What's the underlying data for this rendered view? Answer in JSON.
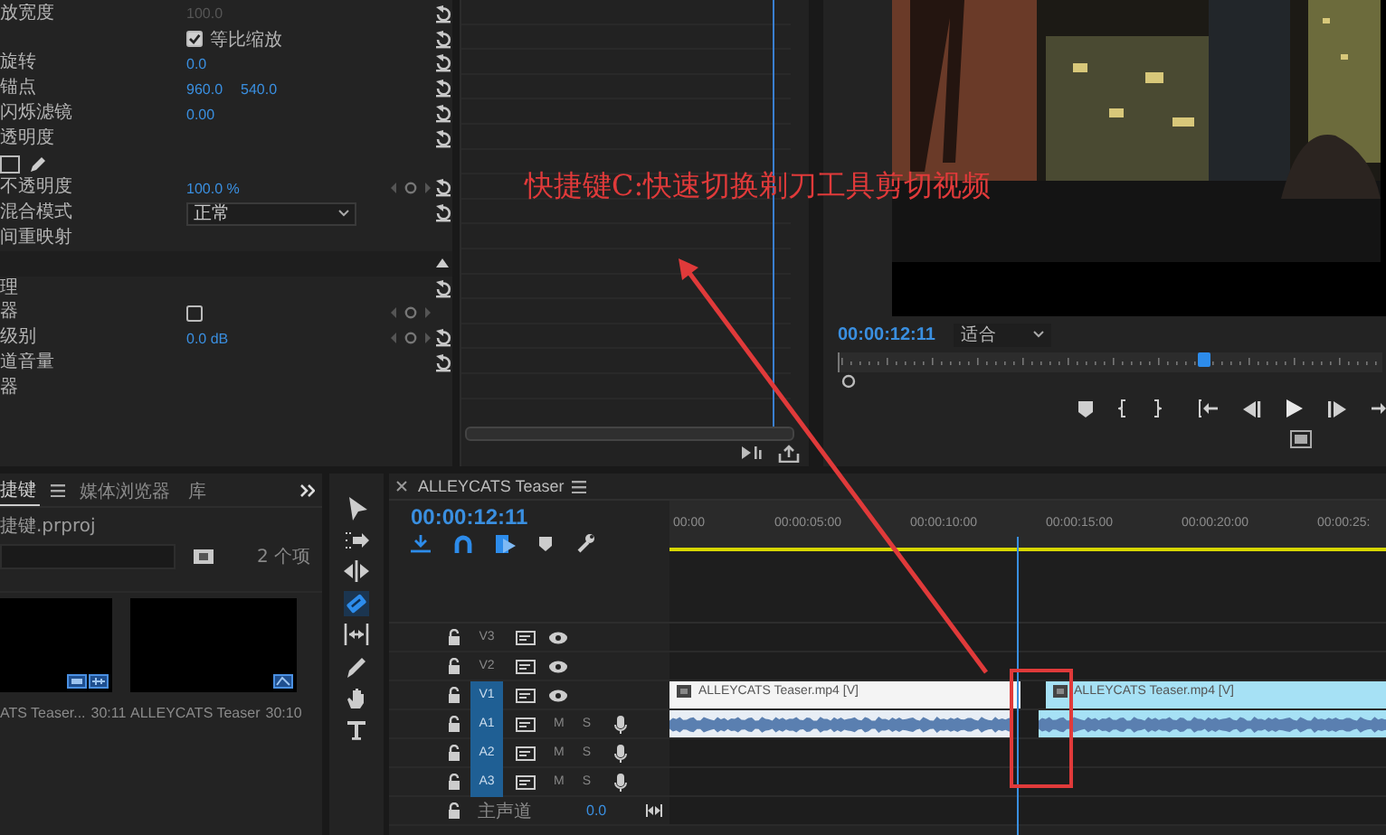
{
  "effect_controls": {
    "rows": [
      {
        "kind": "value",
        "label": "放宽度",
        "values": [
          "100.0"
        ],
        "dim": true,
        "reset": true
      },
      {
        "kind": "checkbox",
        "text": "等比缩放",
        "checked": true,
        "reset": true
      },
      {
        "kind": "value",
        "label": "旋转",
        "values": [
          "0.0"
        ],
        "reset": true
      },
      {
        "kind": "value",
        "label": "锚点",
        "values": [
          "960.0",
          "540.0"
        ],
        "reset": true
      },
      {
        "kind": "value",
        "label": "闪烁滤镜",
        "values": [
          "0.00"
        ],
        "reset": true
      },
      {
        "kind": "section",
        "label": "透明度",
        "reset": true
      },
      {
        "kind": "mask_tools"
      },
      {
        "kind": "value",
        "label": "不透明度",
        "values": [
          "100.0 %"
        ],
        "keyframes": true,
        "reset": true
      },
      {
        "kind": "dropdown",
        "label": "混合模式",
        "value": "正常",
        "reset": true
      },
      {
        "kind": "section",
        "label": "间重映射"
      },
      {
        "kind": "bar"
      },
      {
        "kind": "section",
        "label": "理",
        "reset": true
      },
      {
        "kind": "toggle",
        "label": "器",
        "checked": false,
        "keyframes": true
      },
      {
        "kind": "value",
        "label": "级别",
        "values": [
          "0.0 dB"
        ],
        "keyframes": true,
        "reset": true
      },
      {
        "kind": "section",
        "label": "道音量",
        "reset": true
      },
      {
        "kind": "section",
        "label": "器"
      }
    ]
  },
  "program_monitor": {
    "timecode": "00:00:12:11",
    "zoom": "适合",
    "playhead": {
      "level": 0.67
    }
  },
  "project": {
    "tabs": [
      {
        "label": "捷键",
        "selected": true
      },
      {
        "label": "媒体浏览器",
        "selected": false
      },
      {
        "label": "库",
        "selected": false
      }
    ],
    "file": "捷键.prproj",
    "item_count": "2 个项",
    "items": [
      {
        "kind": "clip",
        "name": "ATS Teaser...",
        "duration": "30:11"
      },
      {
        "kind": "sequence",
        "name": "ALLEYCATS Teaser",
        "duration": "30:10"
      }
    ]
  },
  "tools": [
    {
      "kind": "select",
      "selected": false
    },
    {
      "kind": "track_select",
      "selected": false
    },
    {
      "kind": "ripple",
      "selected": false
    },
    {
      "kind": "razor",
      "selected": true
    },
    {
      "kind": "slip",
      "selected": false
    },
    {
      "kind": "pen",
      "selected": false
    },
    {
      "kind": "hand",
      "selected": false
    },
    {
      "kind": "type",
      "selected": false
    }
  ],
  "timeline": {
    "title": "ALLEYCATS Teaser",
    "timecode": "00:00:12:11",
    "ruler": [
      "00:00",
      "00:00:05:00",
      "00:00:10:00",
      "00:00:15:00",
      "00:00:20:00",
      "00:00:25:"
    ],
    "playhead": {
      "level": 0.48
    },
    "tracks": [
      {
        "kind": "video",
        "name": "V3",
        "targeted": false
      },
      {
        "kind": "video",
        "name": "V2",
        "targeted": false
      },
      {
        "kind": "video",
        "name": "V1",
        "targeted": true,
        "clips": [
          {
            "label": "ALLEYCATS Teaser.mp4 [V]",
            "selected": false
          },
          {
            "label": "ALLEYCATS Teaser.mp4 [V]",
            "selected": true
          }
        ]
      },
      {
        "kind": "audio",
        "name": "A1",
        "targeted": true,
        "buttons": [
          "M",
          "S"
        ],
        "clips": [
          {
            "selected": false
          },
          {
            "selected": true
          }
        ]
      },
      {
        "kind": "audio",
        "name": "A2",
        "targeted": true,
        "buttons": [
          "M",
          "S"
        ]
      },
      {
        "kind": "audio",
        "name": "A3",
        "targeted": true,
        "buttons": [
          "M",
          "S"
        ]
      }
    ],
    "master": {
      "name": "主声道",
      "value": "0.0"
    }
  },
  "annotation": {
    "text": "快捷键C:快速切换剃刀工具剪切视频"
  }
}
